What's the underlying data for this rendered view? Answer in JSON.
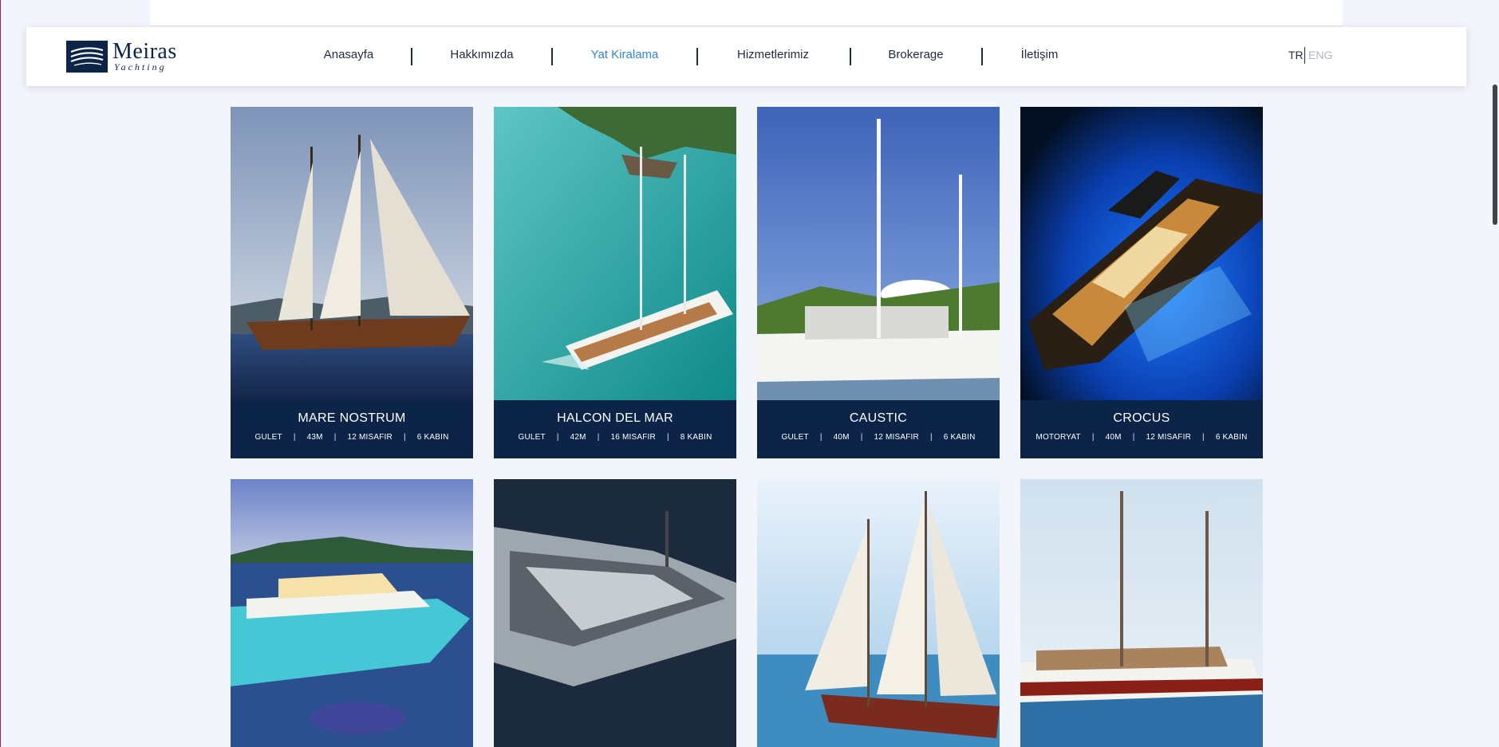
{
  "brand": {
    "name": "Meiras",
    "subtitle": "Yachting",
    "colors": {
      "navy": "#0b2447",
      "accent": "#2e86de"
    }
  },
  "nav": {
    "items": [
      {
        "label": "Anasayfa",
        "active": false
      },
      {
        "label": "Hakkımızda",
        "active": false
      },
      {
        "label": "Yat Kiralama",
        "active": true
      },
      {
        "label": "Hizmetlerimiz",
        "active": false
      },
      {
        "label": "Brokerage",
        "active": false
      },
      {
        "label": "İletişim",
        "active": false
      }
    ]
  },
  "language": {
    "tr": "TR",
    "en": "ENG",
    "selected": "TR"
  },
  "yachts": [
    {
      "name": "MARE NOSTRUM",
      "type": "GULET",
      "length": "43M",
      "guests": "12 MISAFIR",
      "cabins": "6 KABIN"
    },
    {
      "name": "HALCON DEL MAR",
      "type": "GULET",
      "length": "42M",
      "guests": "16 MISAFIR",
      "cabins": "8 KABIN"
    },
    {
      "name": "CAUSTIC",
      "type": "GULET",
      "length": "40M",
      "guests": "12 MISAFIR",
      "cabins": "6 KABIN"
    },
    {
      "name": "CROCUS",
      "type": "MOTORYAT",
      "length": "40M",
      "guests": "12 MISAFIR",
      "cabins": "6 KABIN"
    },
    {
      "name": ""
    },
    {
      "name": ""
    },
    {
      "name": ""
    },
    {
      "name": ""
    }
  ]
}
